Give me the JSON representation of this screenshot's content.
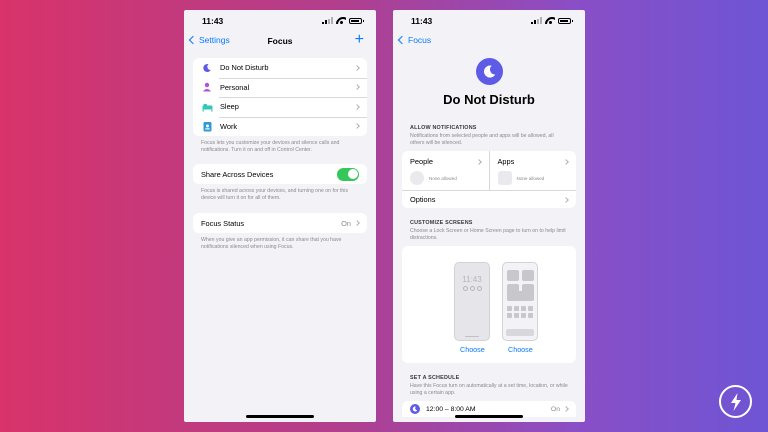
{
  "status_time": "11:43",
  "left": {
    "back_label": "Settings",
    "title": "Focus",
    "add_label": "+",
    "modes": [
      {
        "label": "Do Not Disturb",
        "icon": "moon-icon",
        "color": "#5e5ce6"
      },
      {
        "label": "Personal",
        "icon": "person-icon",
        "color": "#af52de"
      },
      {
        "label": "Sleep",
        "icon": "bed-icon",
        "color": "#30c8b8"
      },
      {
        "label": "Work",
        "icon": "badge-icon",
        "color": "#2e9bd6"
      }
    ],
    "modes_footer": "Focus lets you customize your devices and silence calls and notifications. Turn it on and off in Control Center.",
    "share_label": "Share Across Devices",
    "share_on": true,
    "share_footer": "Focus is shared across your devices, and turning one on for this device will turn it on for all of them.",
    "status_label": "Focus Status",
    "status_value": "On",
    "status_footer": "When you give an app permission, it can share that you have notifications silenced when using Focus."
  },
  "right": {
    "back_label": "Focus",
    "title": "Do Not Disturb",
    "allow_header": "ALLOW NOTIFICATIONS",
    "allow_sub": "Notifications from selected people and apps will be allowed, all others will be silenced.",
    "people_label": "People",
    "people_none": "None allowed",
    "apps_label": "Apps",
    "apps_none": "None allowed",
    "options_label": "Options",
    "customize_header": "CUSTOMIZE SCREENS",
    "customize_sub": "Choose a Lock Screen or Home Screen page to turn on to help limit distractions.",
    "lock_time": "11:43",
    "choose_lock": "Choose",
    "choose_home": "Choose",
    "schedule_header": "SET A SCHEDULE",
    "schedule_sub": "Have this Focus turn on automatically at a set time, location, or while using a certain app.",
    "schedule_item": "12:00 – 8:00 AM",
    "schedule_value": "On"
  },
  "accent": "#0a7aff",
  "toggle_color": "#34c759"
}
